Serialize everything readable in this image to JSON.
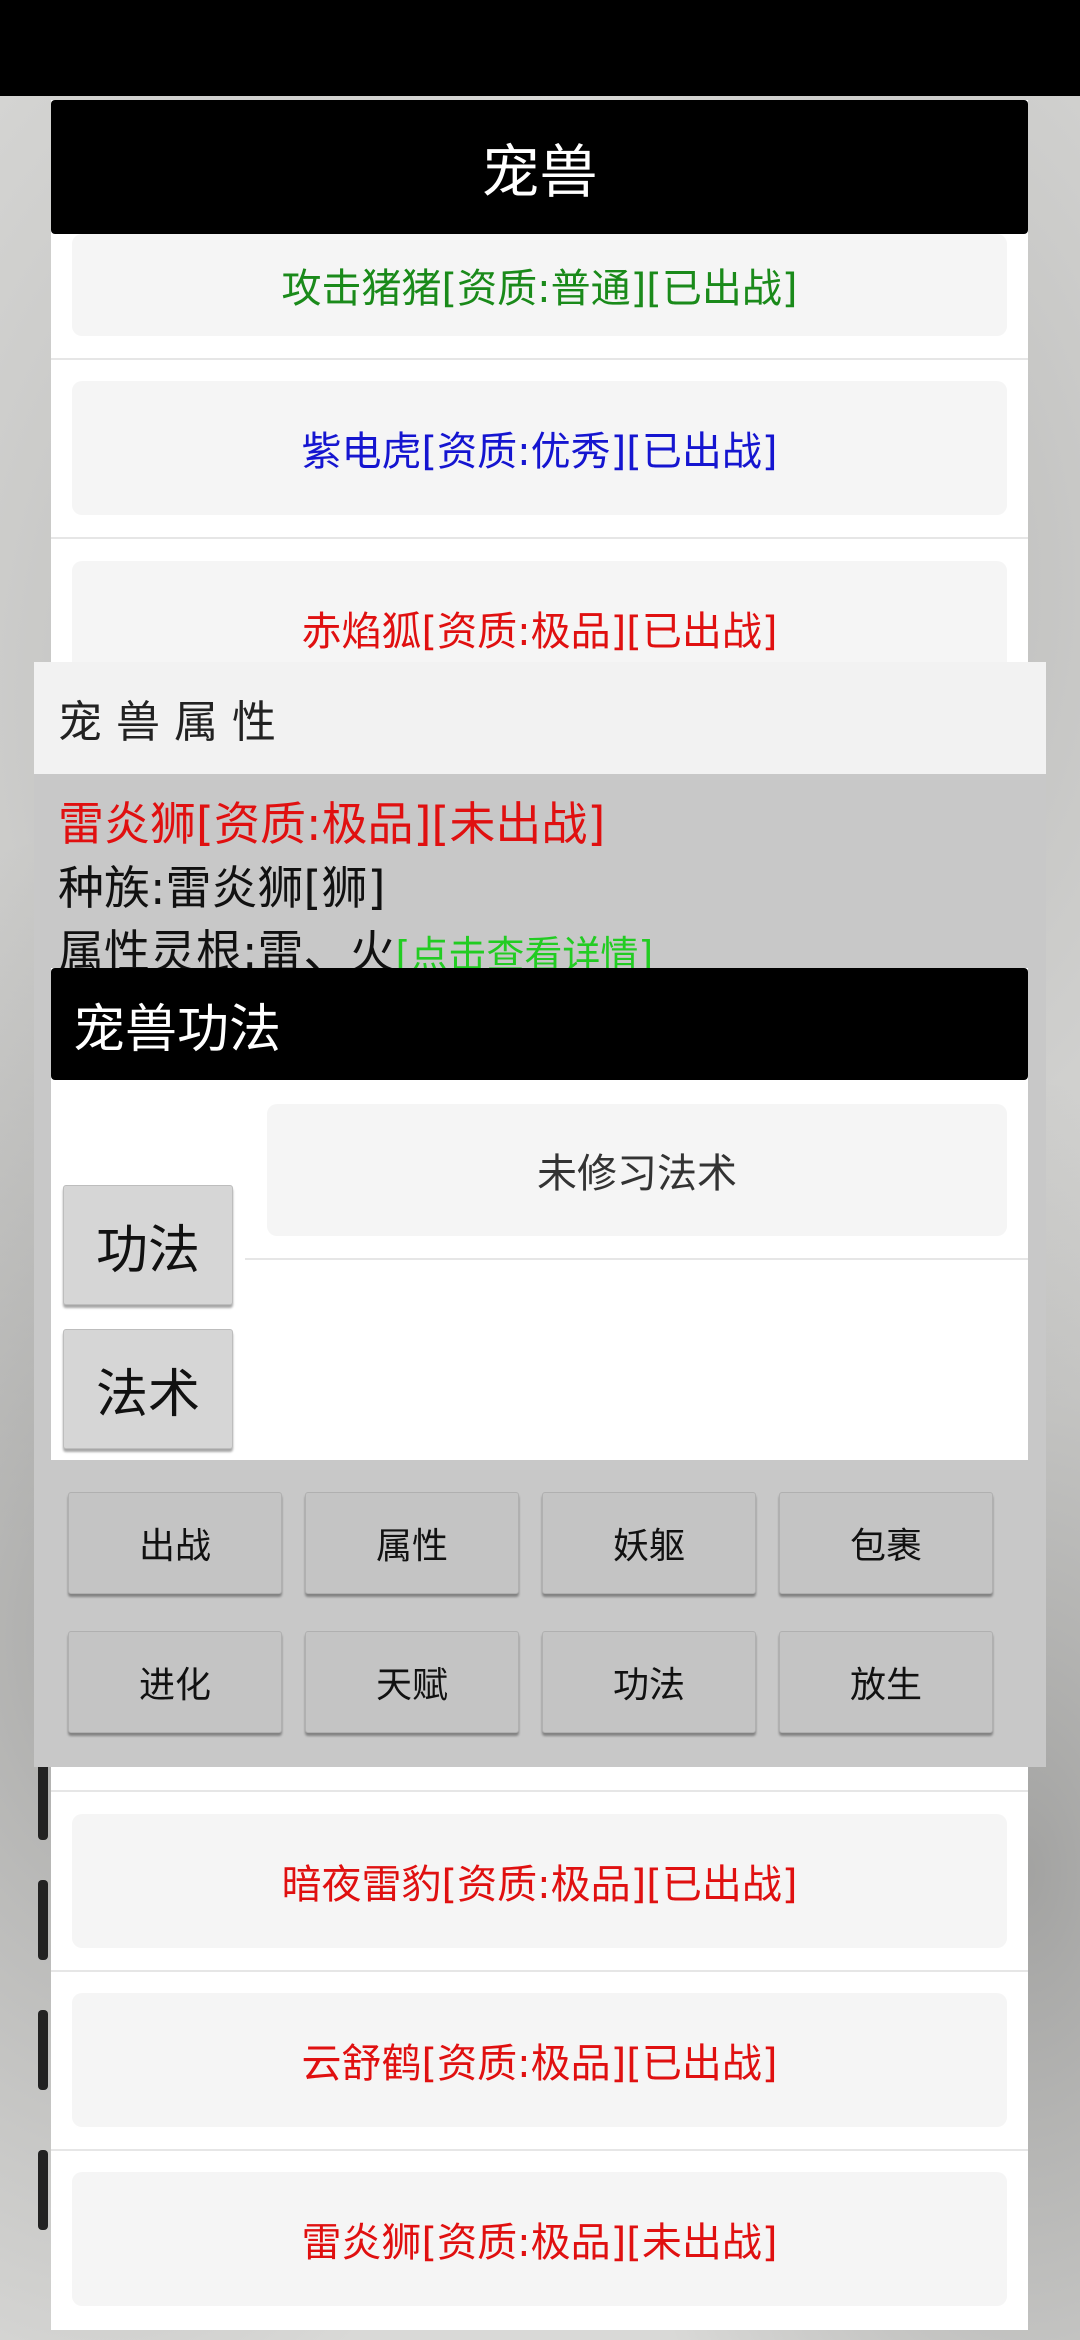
{
  "header": {
    "title": "宠兽"
  },
  "pets": [
    {
      "label": "攻击猪猪[资质:普通][已出战]",
      "color": "#1a8a1a"
    },
    {
      "label": "紫电虎[资质:优秀][已出战]",
      "color": "#1515d0"
    },
    {
      "label": "赤焰狐[资质:极品][已出战]",
      "color": "#e01010"
    },
    {
      "label": "暗夜雷豹[资质:极品][已出战]",
      "color": "#e01010"
    },
    {
      "label": "云舒鹤[资质:极品][已出战]",
      "color": "#e01010"
    },
    {
      "label": "雷炎狮[资质:极品][未出战]",
      "color": "#e01010"
    }
  ],
  "attributes": {
    "title": "宠兽属性",
    "name_line": "雷炎狮[资质:极品][未出战]",
    "race_line": "种族:雷炎狮[狮]",
    "root_line": "属性灵根:雷、火",
    "detail_link": "[点击查看详情]"
  },
  "skills": {
    "title": "宠兽功法",
    "empty_text": "未修习法术",
    "tab_gongfa": "功法",
    "tab_fashu": "法术"
  },
  "actions": [
    "出战",
    "属性",
    "妖躯",
    "包裹",
    "进化",
    "天赋",
    "功法",
    "放生"
  ]
}
